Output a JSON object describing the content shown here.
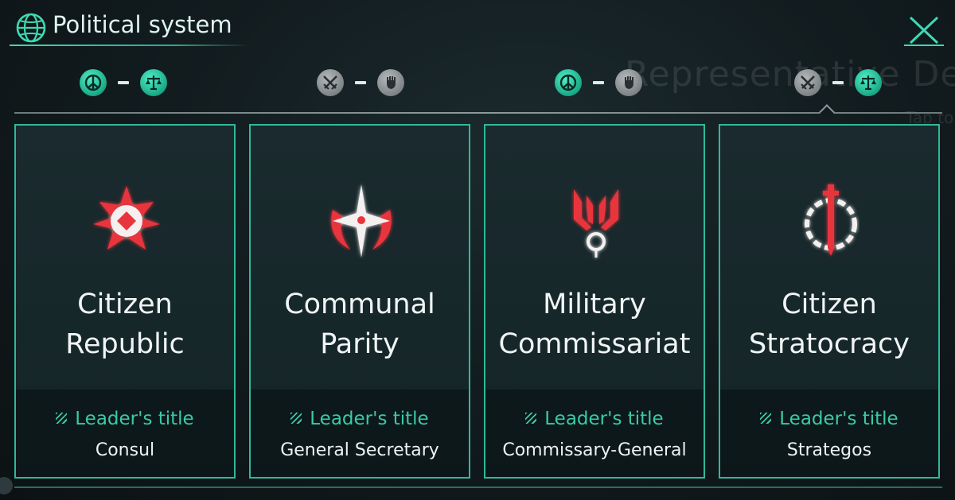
{
  "header": {
    "title": "Political system",
    "globe_icon": "globe-icon",
    "close_icon": "close-icon"
  },
  "background": {
    "ghost_text": "Representative Dem",
    "ghost_small": "Tap to"
  },
  "colors": {
    "accent": "#2fb99a",
    "accent_text": "#3bcaa6",
    "emblem_red": "#e8343c",
    "badge_teal": "#1aa886",
    "badge_grey": "#7d8386"
  },
  "ideologies": [
    {
      "left": {
        "icon": "peace-icon",
        "color": "teal"
      },
      "right": {
        "icon": "scales-icon",
        "color": "teal"
      }
    },
    {
      "left": {
        "icon": "crossed-swords-icon",
        "color": "grey"
      },
      "right": {
        "icon": "fist-icon",
        "color": "grey"
      }
    },
    {
      "left": {
        "icon": "peace-icon",
        "color": "teal"
      },
      "right": {
        "icon": "fist-icon",
        "color": "grey"
      }
    },
    {
      "left": {
        "icon": "crossed-swords-icon",
        "color": "grey"
      },
      "right": {
        "icon": "scales-icon",
        "color": "teal"
      }
    }
  ],
  "systems": [
    {
      "name_line1": "Citizen",
      "name_line2": "Republic",
      "leader_title_label": "Leader's title",
      "leader_title": "Consul",
      "emblem": "republic-emblem-icon"
    },
    {
      "name_line1": "Communal",
      "name_line2": "Parity",
      "leader_title_label": "Leader's title",
      "leader_title": "General Secretary",
      "emblem": "parity-emblem-icon"
    },
    {
      "name_line1": "Military",
      "name_line2": "Commissariat",
      "leader_title_label": "Leader's title",
      "leader_title": "Commissary-General",
      "emblem": "commissariat-emblem-icon"
    },
    {
      "name_line1": "Citizen",
      "name_line2": "Stratocracy",
      "leader_title_label": "Leader's title",
      "leader_title": "Strategos",
      "emblem": "stratocracy-emblem-icon"
    }
  ]
}
